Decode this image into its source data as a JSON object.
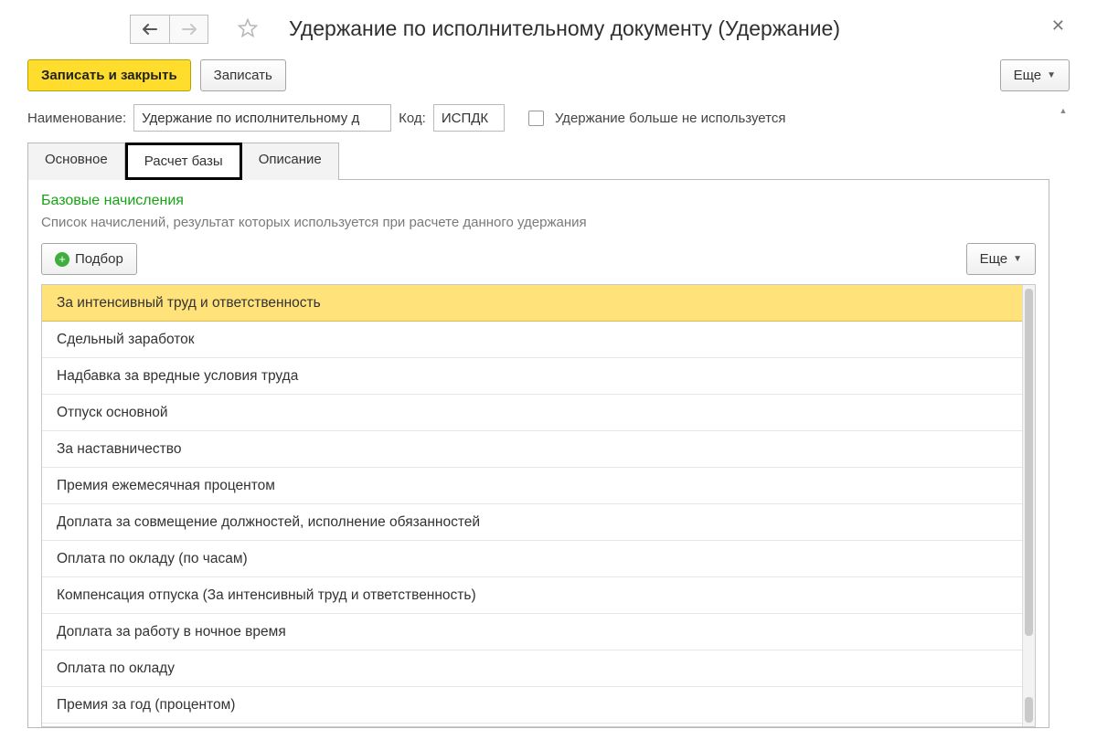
{
  "title": "Удержание по исполнительному документу (Удержание)",
  "toolbar": {
    "save_close": "Записать и закрыть",
    "save": "Записать",
    "more": "Еще"
  },
  "form": {
    "name_label": "Наименование:",
    "name_value": "Удержание по исполнительному д",
    "code_label": "Код:",
    "code_value": "ИСПДК",
    "unused_label": "Удержание больше не используется"
  },
  "tabs": {
    "t1": "Основное",
    "t2": "Расчет базы",
    "t3": "Описание"
  },
  "panel": {
    "section_title": "Базовые начисления",
    "section_sub": "Список начислений, результат которых используется при расчете данного удержания",
    "pick": "Подбор",
    "more": "Еще"
  },
  "rows": [
    "За интенсивный труд и ответственность",
    "Сдельный заработок",
    "Надбавка за вредные условия труда",
    "Отпуск основной",
    "За наставничество",
    "Премия ежемесячная процентом",
    "Доплата за совмещение должностей, исполнение обязанностей",
    "Оплата по окладу (по часам)",
    "Компенсация отпуска (За интенсивный труд и ответственность)",
    "Доплата за работу в ночное время",
    "Оплата по окладу",
    "Премия за год (процентом)"
  ]
}
